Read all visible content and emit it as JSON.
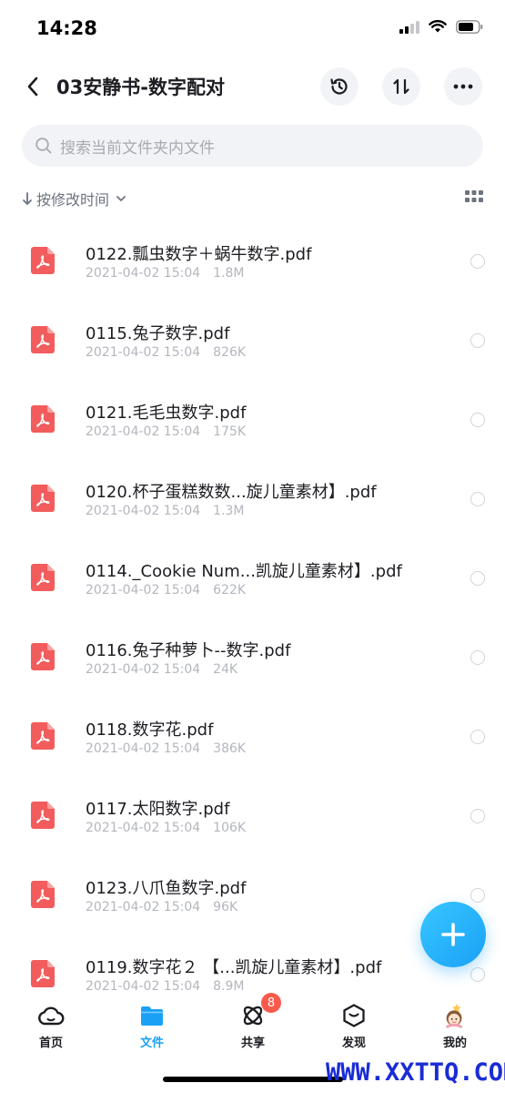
{
  "status_bar": {
    "time": "14:28"
  },
  "nav": {
    "title": "03安静书-数字配对"
  },
  "search": {
    "placeholder": "搜索当前文件夹内文件"
  },
  "sort": {
    "label": "按修改时间"
  },
  "files": [
    {
      "name": "0122.瓢虫数字＋蜗牛数字.pdf",
      "date": "2021-04-02 15:04",
      "size": "1.8M"
    },
    {
      "name": "0115.兔子数字.pdf",
      "date": "2021-04-02 15:04",
      "size": "826K"
    },
    {
      "name": "0121.毛毛虫数字.pdf",
      "date": "2021-04-02 15:04",
      "size": "175K"
    },
    {
      "name": "0120.杯子蛋糕数数...旋儿童素材】.pdf",
      "date": "2021-04-02 15:04",
      "size": "1.3M"
    },
    {
      "name": "0114._Cookie Num...凯旋儿童素材】.pdf",
      "date": "2021-04-02 15:04",
      "size": "622K"
    },
    {
      "name": "0116.兔子种萝卜--数字.pdf",
      "date": "2021-04-02 15:04",
      "size": "24K"
    },
    {
      "name": "0118.数字花.pdf",
      "date": "2021-04-02 15:04",
      "size": "386K"
    },
    {
      "name": "0117.太阳数字.pdf",
      "date": "2021-04-02 15:04",
      "size": "106K"
    },
    {
      "name": "0123.八爪鱼数字.pdf",
      "date": "2021-04-02 15:04",
      "size": "96K"
    },
    {
      "name": "0119.数字花２ 【...凯旋儿童素材】.pdf",
      "date": "2021-04-02 15:04",
      "size": "8.9M"
    }
  ],
  "tabs": {
    "home": "首页",
    "files": "文件",
    "share": "共享",
    "share_badge": "8",
    "discover": "发现",
    "mine": "我的"
  },
  "watermark": "WWW.XXTTQ.COM",
  "colors": {
    "accent": "#1aa1f6",
    "pdf_red": "#f25c5c",
    "badge": "#fa5a4c"
  }
}
